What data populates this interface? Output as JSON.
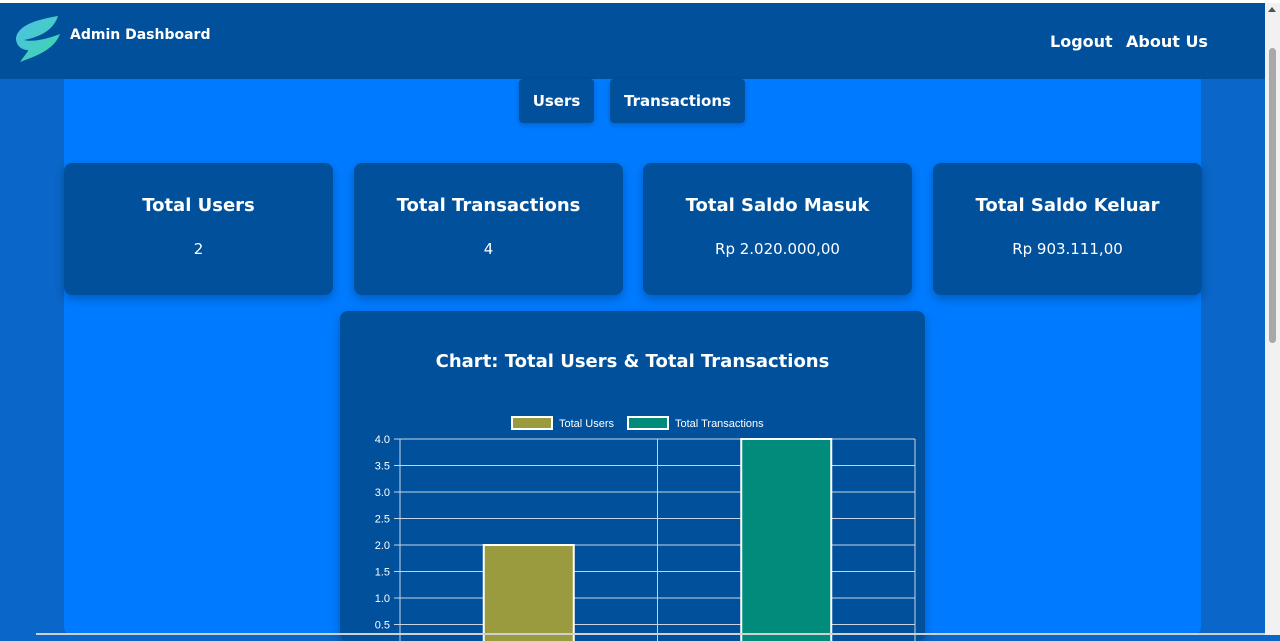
{
  "header": {
    "brand": "Admin Dashboard",
    "nav": [
      {
        "label": "Logout"
      },
      {
        "label": "About Us"
      }
    ]
  },
  "tabs": [
    {
      "label": "Users"
    },
    {
      "label": "Transactions"
    }
  ],
  "stats": [
    {
      "title": "Total Users",
      "value": "2"
    },
    {
      "title": "Total Transactions",
      "value": "4"
    },
    {
      "title": "Total Saldo Masuk",
      "value": "Rp 2.020.000,00"
    },
    {
      "title": "Total Saldo Keluar",
      "value": "Rp 903.111,00"
    }
  ],
  "chart_title": "Chart: Total Users & Total Transactions",
  "chart_data": {
    "type": "bar",
    "title": "",
    "xlabel": "",
    "ylabel": "",
    "ylim": [
      0,
      4
    ],
    "y_ticks": [
      "0.5",
      "1.0",
      "1.5",
      "2.0",
      "2.5",
      "3.0",
      "3.5",
      "4.0"
    ],
    "legend_position": "top",
    "grid": true,
    "series": [
      {
        "name": "Total Users",
        "values": [
          2
        ],
        "color": "#9a9a3f"
      },
      {
        "name": "Total Transactions",
        "values": [
          4
        ],
        "color": "#008b7a"
      }
    ]
  },
  "colors": {
    "page_bg": "#0a66c9",
    "navbar": "#00509c",
    "content_bg": "#007bff",
    "card": "#00509c"
  }
}
